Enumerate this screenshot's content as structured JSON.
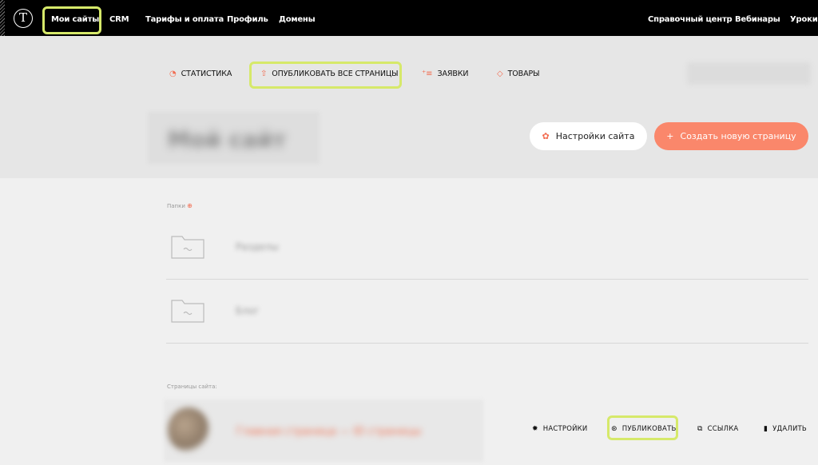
{
  "nav": {
    "logo": "T",
    "items": [
      {
        "label": "Мои сайты"
      },
      {
        "label": "CRM"
      },
      {
        "label": "Тарифы и оплата"
      },
      {
        "label": "Профиль"
      },
      {
        "label": "Домены"
      }
    ],
    "right_items": [
      {
        "label": "Справочный центр"
      },
      {
        "label": "Вебинары"
      },
      {
        "label": "Уроки н"
      }
    ]
  },
  "toolbar": {
    "statistics": "СТАТИСТИКА",
    "publish_all": "ОПУБЛИКОВАТЬ ВСЕ СТРАНИЦЫ",
    "requests": "ЗАЯВКИ",
    "products": "ТОВАРЫ"
  },
  "site": {
    "title_blurred": "Мой сайт",
    "settings_button": "Настройки сайта",
    "create_button": "Создать новую страницу"
  },
  "folders": {
    "label": "Папки",
    "items": [
      {
        "name": "Разделы"
      },
      {
        "name": "Блог"
      }
    ]
  },
  "pages": {
    "label": "Страницы сайта:",
    "items": [
      {
        "title_blurred": "Главная страница — ID страницы",
        "actions": {
          "settings": "НАСТРОЙКИ",
          "publish": "ПУБЛИКОВАТЬ",
          "link": "ССЫЛКА",
          "delete": "УДАЛИТЬ"
        }
      }
    ]
  },
  "colors": {
    "accent": "#f26b4f",
    "create_button": "#fa876b",
    "highlight": "#d6e96a"
  }
}
